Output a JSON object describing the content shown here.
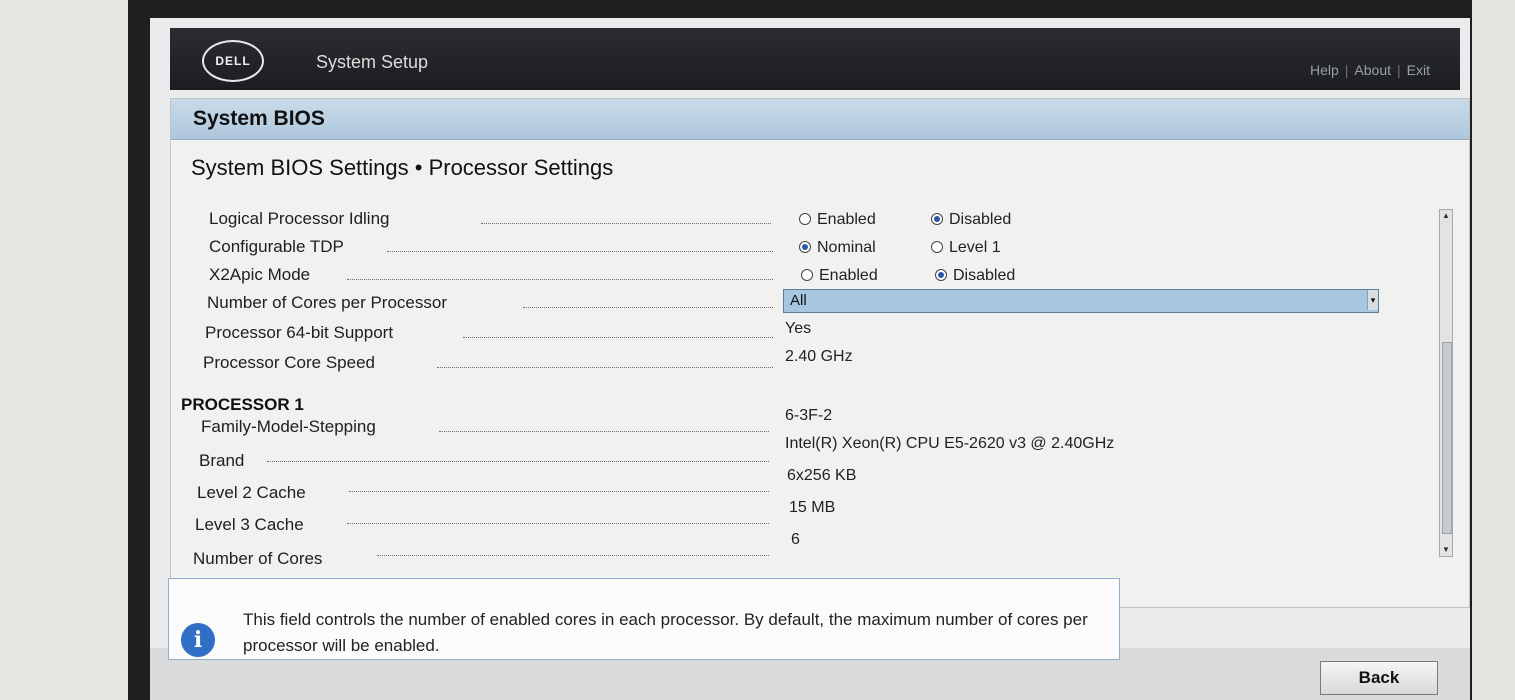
{
  "header": {
    "logo_text": "DELL",
    "title": "System Setup",
    "links": [
      "Help",
      "About",
      "Exit"
    ]
  },
  "panel": {
    "title": "System BIOS",
    "section_title": "System BIOS Settings • Processor Settings"
  },
  "settings": [
    {
      "label": "Logical Processor Idling",
      "type": "radio",
      "options": [
        "Enabled",
        "Disabled"
      ],
      "selected": "Disabled"
    },
    {
      "label": "Configurable TDP",
      "type": "radio",
      "options": [
        "Nominal",
        "Level 1"
      ],
      "selected": "Nominal"
    },
    {
      "label": "X2Apic Mode",
      "type": "radio",
      "options": [
        "Enabled",
        "Disabled"
      ],
      "selected": "Disabled"
    },
    {
      "label": "Number of Cores per Processor",
      "type": "select",
      "value": "All"
    },
    {
      "label": "Processor 64-bit Support",
      "type": "text",
      "value": "Yes"
    },
    {
      "label": "Processor Core Speed",
      "type": "text",
      "value": "2.40 GHz"
    }
  ],
  "processor1": {
    "heading": "PROCESSOR 1",
    "fields": [
      {
        "label": "Family-Model-Stepping",
        "value": "6-3F-2"
      },
      {
        "label": "Brand",
        "value": "Intel(R) Xeon(R) CPU E5-2620 v3 @ 2.40GHz"
      },
      {
        "label": "Level 2 Cache",
        "value": "6x256 KB"
      },
      {
        "label": "Level 3 Cache",
        "value": "15 MB"
      },
      {
        "label": "Number of Cores",
        "value": "6"
      }
    ]
  },
  "help": {
    "text": "This field controls the number of enabled cores in each processor. By default, the maximum number of cores per processor will be enabled."
  },
  "footer": {
    "back_label": "Back"
  }
}
